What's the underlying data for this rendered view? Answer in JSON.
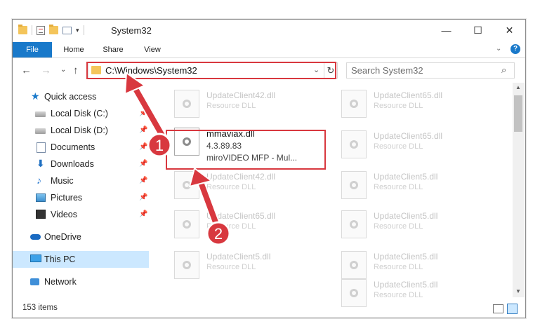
{
  "window": {
    "title": "System32",
    "controls": {
      "minimize": "—",
      "maximize": "☐",
      "close": "✕"
    }
  },
  "ribbon": {
    "tabs": [
      "File",
      "Home",
      "Share",
      "View"
    ],
    "help": "?",
    "chevron": "⌄"
  },
  "nav": {
    "back": "←",
    "forward": "→",
    "recent": "⌄",
    "up": "↑",
    "address": "C:\\Windows\\System32",
    "address_drop": "⌄",
    "refresh": "↻",
    "search_placeholder": "Search System32"
  },
  "sidebar": {
    "items": [
      {
        "label": "Quick access",
        "icon": "star-icon",
        "pinned": false
      },
      {
        "label": "Local Disk (C:)",
        "icon": "disk-icon",
        "pinned": true
      },
      {
        "label": "Local Disk (D:)",
        "icon": "disk-icon",
        "pinned": true
      },
      {
        "label": "Documents",
        "icon": "documents-icon",
        "pinned": true
      },
      {
        "label": "Downloads",
        "icon": "download-icon",
        "pinned": true
      },
      {
        "label": "Music",
        "icon": "music-icon",
        "pinned": true
      },
      {
        "label": "Pictures",
        "icon": "pictures-icon",
        "pinned": true
      },
      {
        "label": "Videos",
        "icon": "videos-icon",
        "pinned": true
      },
      {
        "label": "OneDrive",
        "icon": "onedrive-icon",
        "pinned": false
      },
      {
        "label": "This PC",
        "icon": "pc-icon",
        "pinned": false,
        "selected": true
      },
      {
        "label": "Network",
        "icon": "network-icon",
        "pinned": false
      }
    ]
  },
  "files": {
    "left_column": [
      {
        "name": "UpdateClient42.dll",
        "type": "Resource DLL"
      },
      {
        "name": "UpdateClient42.dll",
        "type": "Resource DLL"
      },
      {
        "name": "UpdateClient65.dll",
        "type": "Resource DLL"
      },
      {
        "name": "UpdateClient5.dll",
        "type": "Resource DLL"
      }
    ],
    "right_column": [
      {
        "name": "UpdateClient65.dll",
        "type": "Resource DLL"
      },
      {
        "name": "UpdateClient65.dll",
        "type": "Resource DLL"
      },
      {
        "name": "UpdateClient5.dll",
        "type": "Resource DLL"
      },
      {
        "name": "UpdateClient5.dll",
        "type": "Resource DLL"
      },
      {
        "name": "UpdateClient5.dll",
        "type": "Resource DLL"
      },
      {
        "name": "UpdateClient5.dll",
        "type": "Resource DLL"
      }
    ],
    "featured": {
      "name": "mmaviax.dll",
      "version": "4.3.89.83",
      "description": "miroVIDEO MFP - Mul..."
    }
  },
  "status": {
    "item_count": "153 items"
  },
  "annotations": {
    "step1": "1",
    "step2": "2",
    "color": "#d8383f"
  }
}
